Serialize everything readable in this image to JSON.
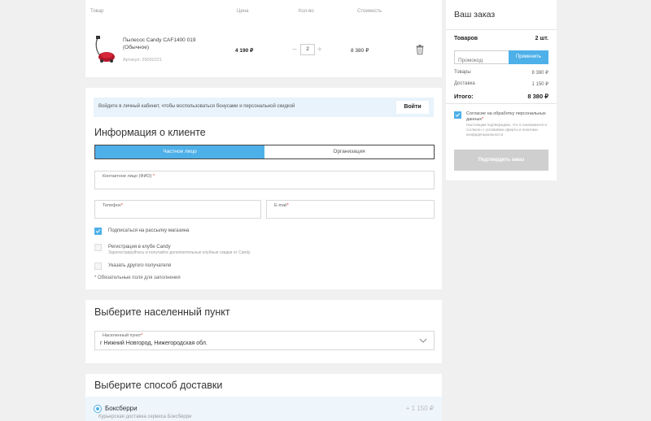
{
  "cart": {
    "headers": {
      "product": "Товар",
      "price": "Цена",
      "qty": "Кол-во",
      "total": "Стоимость"
    },
    "item": {
      "name": "Пылесос Candy CAF1400 019 (Обычное)",
      "sku": "Артикул: 39002221",
      "price": "4 190 ₽",
      "qty": "2",
      "total": "8 380 ₽"
    }
  },
  "client": {
    "login_prompt": "Войдите в личный кабинет, чтобы воспользоваться бонусами и персональной скидкой",
    "login_button": "Войти",
    "title": "Информация о клиенте",
    "tabs": [
      "Частное лицо",
      "Организация"
    ],
    "fields": {
      "contact": "Контактное лицо (ФИО)",
      "phone": "Телефон",
      "email": "E-mail"
    },
    "checkboxes": {
      "subscribe": "Подписаться на рассылку магазина",
      "club": "Регистрация в клубе Candy",
      "club_sub": "Зарегистрируйтесь и получайте дополнительные клубные скидки от Candy",
      "other_recipient": "Указать другого получателя"
    },
    "required_note": "* Обязательные поля для заполнения"
  },
  "city": {
    "title": "Выберите населенный пункт",
    "label": "Населенный пункт",
    "value": "г Нижний Новгород, Нижегородская обл."
  },
  "delivery": {
    "title": "Выберите способ доставки",
    "option_name": "Боксберри",
    "option_price": "+ 1 150 ₽",
    "option_sub": "Курьерская доставка сервиса Боксберри"
  },
  "summary": {
    "title": "Ваш заказ",
    "items_label": "Товаров",
    "items_count": "2 шт.",
    "promo_placeholder": "Промокод",
    "apply_button": "Применить",
    "goods_label": "Товары",
    "goods_value": "8 380 ₽",
    "delivery_label": "Доставка",
    "delivery_value": "1 150 ₽",
    "total_label": "Итого:",
    "total_value": "8 380 ₽",
    "agree_text": "Согласие на обработку персональных данных",
    "agree_sub": "Настоящим подтверждаю, что я ознакомился и согласен с условиями оферты и политики конфиденциальности",
    "confirm_button": "Подтвердить заказ"
  },
  "colors": {
    "accent": "#4eb0e8",
    "background": "#f0f0f0",
    "disabled": "#cfcfcf"
  }
}
